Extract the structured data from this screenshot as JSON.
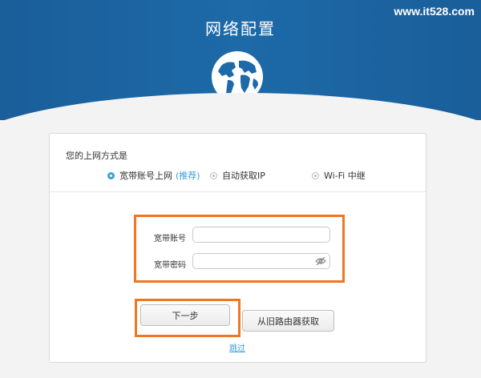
{
  "header": {
    "title": "网络配置",
    "watermark": "www.it528.com",
    "icon": "globe-icon"
  },
  "connection": {
    "question": "您的上网方式是",
    "options": [
      {
        "label": "宽带账号上网",
        "badge": "(推荐)",
        "selected": true
      },
      {
        "label": "自动获取IP",
        "selected": false
      },
      {
        "label": "Wi-Fi 中继",
        "selected": false
      }
    ]
  },
  "form": {
    "account_label": "宽带账号",
    "account_value": "",
    "password_label": "宽带密码",
    "password_value": "",
    "password_toggle_icon": "eye-icon"
  },
  "actions": {
    "next_label": "下一步",
    "import_label": "从旧路由器获取",
    "skip_label": "跳过"
  },
  "colors": {
    "header_blue": "#1d6aa8",
    "accent_blue": "#3d9fd6",
    "highlight_orange": "#f07622"
  }
}
